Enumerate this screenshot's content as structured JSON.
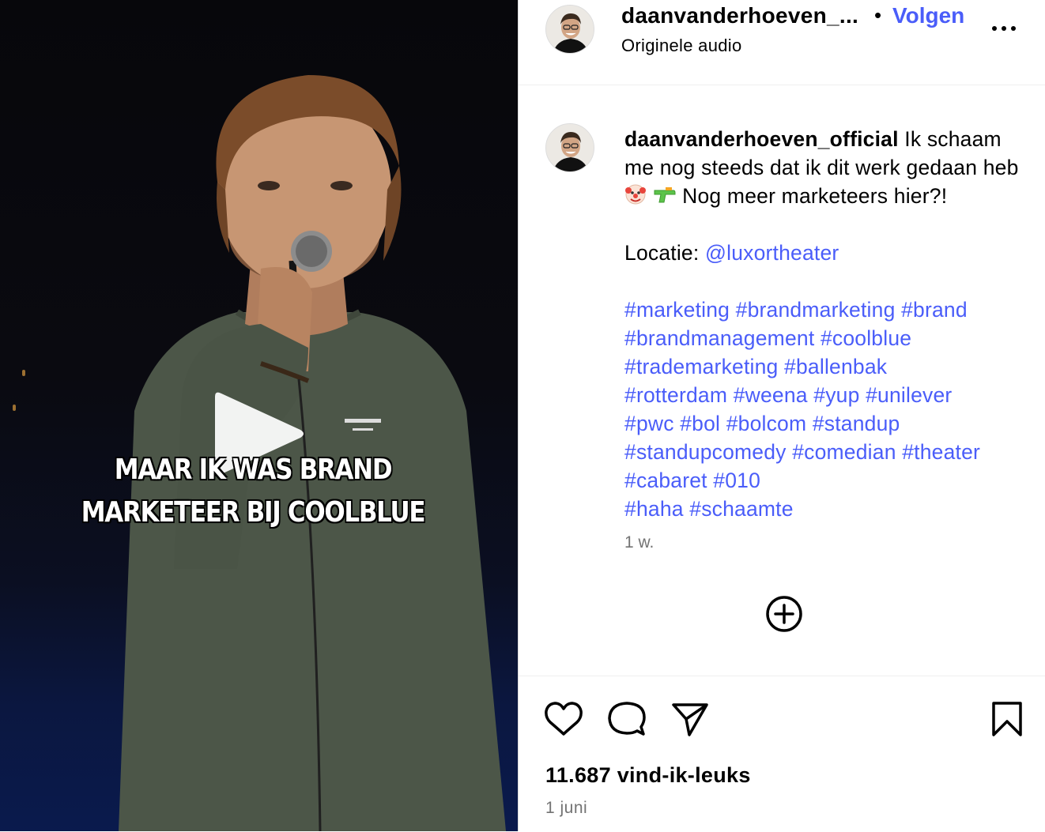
{
  "video": {
    "caption_line1": "MAAR IK WAS BRAND",
    "caption_line2": "MARKETEER BIJ COOLBLUE"
  },
  "header": {
    "username": "daanvanderhoeven_...",
    "separator": "•",
    "follow_label": "Volgen",
    "audio": "Originele audio"
  },
  "comment": {
    "username": "daanvanderhoeven_official",
    "text_part1": "Ik schaam me nog steeds dat ik dit werk gedaan heb",
    "emojis": [
      "clown-face",
      "water-pistol"
    ],
    "text_part2": "Nog meer marketeers hier?!",
    "location_label": "Locatie:",
    "location_mention": "@luxortheater",
    "hashtags_lines": [
      "#marketing #brandmarketing #brand",
      "#brandmanagement #coolblue",
      "#trademarketing #ballenbak",
      "#rotterdam #weena #yup #unilever",
      "#pwc #bol #bolcom #standup",
      "#standupcomedy #comedian #theater",
      "#cabaret #010",
      "#haha #schaamte"
    ],
    "time_ago": "1 w."
  },
  "actions": {
    "icons": [
      "heart-icon",
      "comment-icon",
      "share-icon",
      "bookmark-icon"
    ],
    "likes": "11.687 vind-ik-leuks",
    "date": "1 juni"
  },
  "colors": {
    "link": "#4a5df9",
    "muted": "#737373",
    "border": "#efefef"
  }
}
